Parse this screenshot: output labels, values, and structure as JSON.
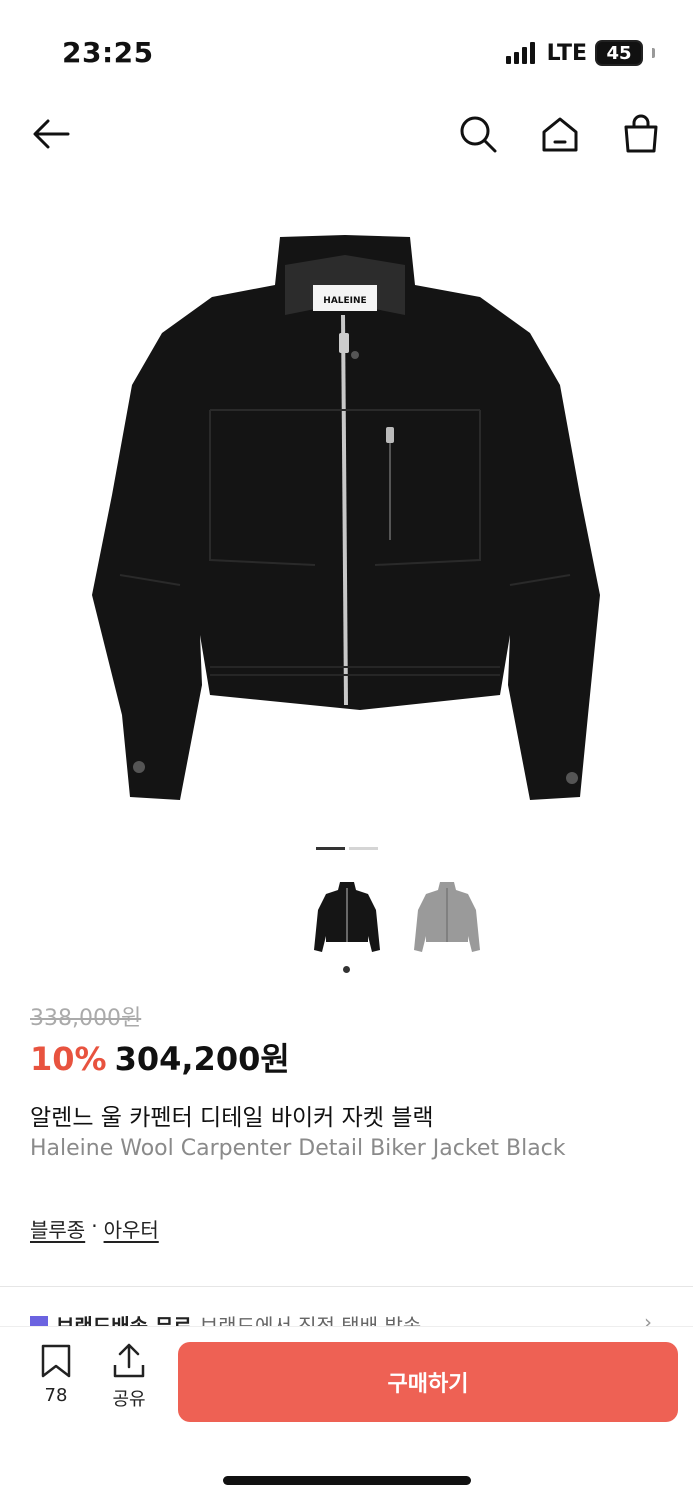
{
  "status_bar": {
    "time": "23:25",
    "network": "LTE",
    "battery": "45"
  },
  "nav": {
    "back_icon": "arrow-left-icon",
    "search_icon": "search-icon",
    "home_icon": "home-icon",
    "cart_icon": "shopping-bag-icon"
  },
  "gallery": {
    "slide_count": 2,
    "active_slide": 1,
    "brand_label": "HALEINE"
  },
  "thumbnails": [
    {
      "color": "#111111",
      "selected": true
    },
    {
      "color": "#9a9a9a",
      "selected": false
    }
  ],
  "product": {
    "original_price": "338,000원",
    "discount": "10%",
    "price": "304,200원",
    "title_ko": "알렌느 울 카펜터 디테일 바이커 자켓 블랙",
    "title_en": "Haleine Wool Carpenter Detail Biker Jacket Black"
  },
  "categories": {
    "primary": "블루종",
    "separator": "·",
    "secondary": "아우터"
  },
  "delivery": {
    "title": "브랜드배송 무료",
    "description": "브랜드에서 직접 택배 발송"
  },
  "bottom_bar": {
    "bookmark_count": "78",
    "share_label": "공유",
    "buy_label": "구매하기"
  },
  "colors": {
    "accent": "#ee6154",
    "discount": "#e8533f"
  }
}
